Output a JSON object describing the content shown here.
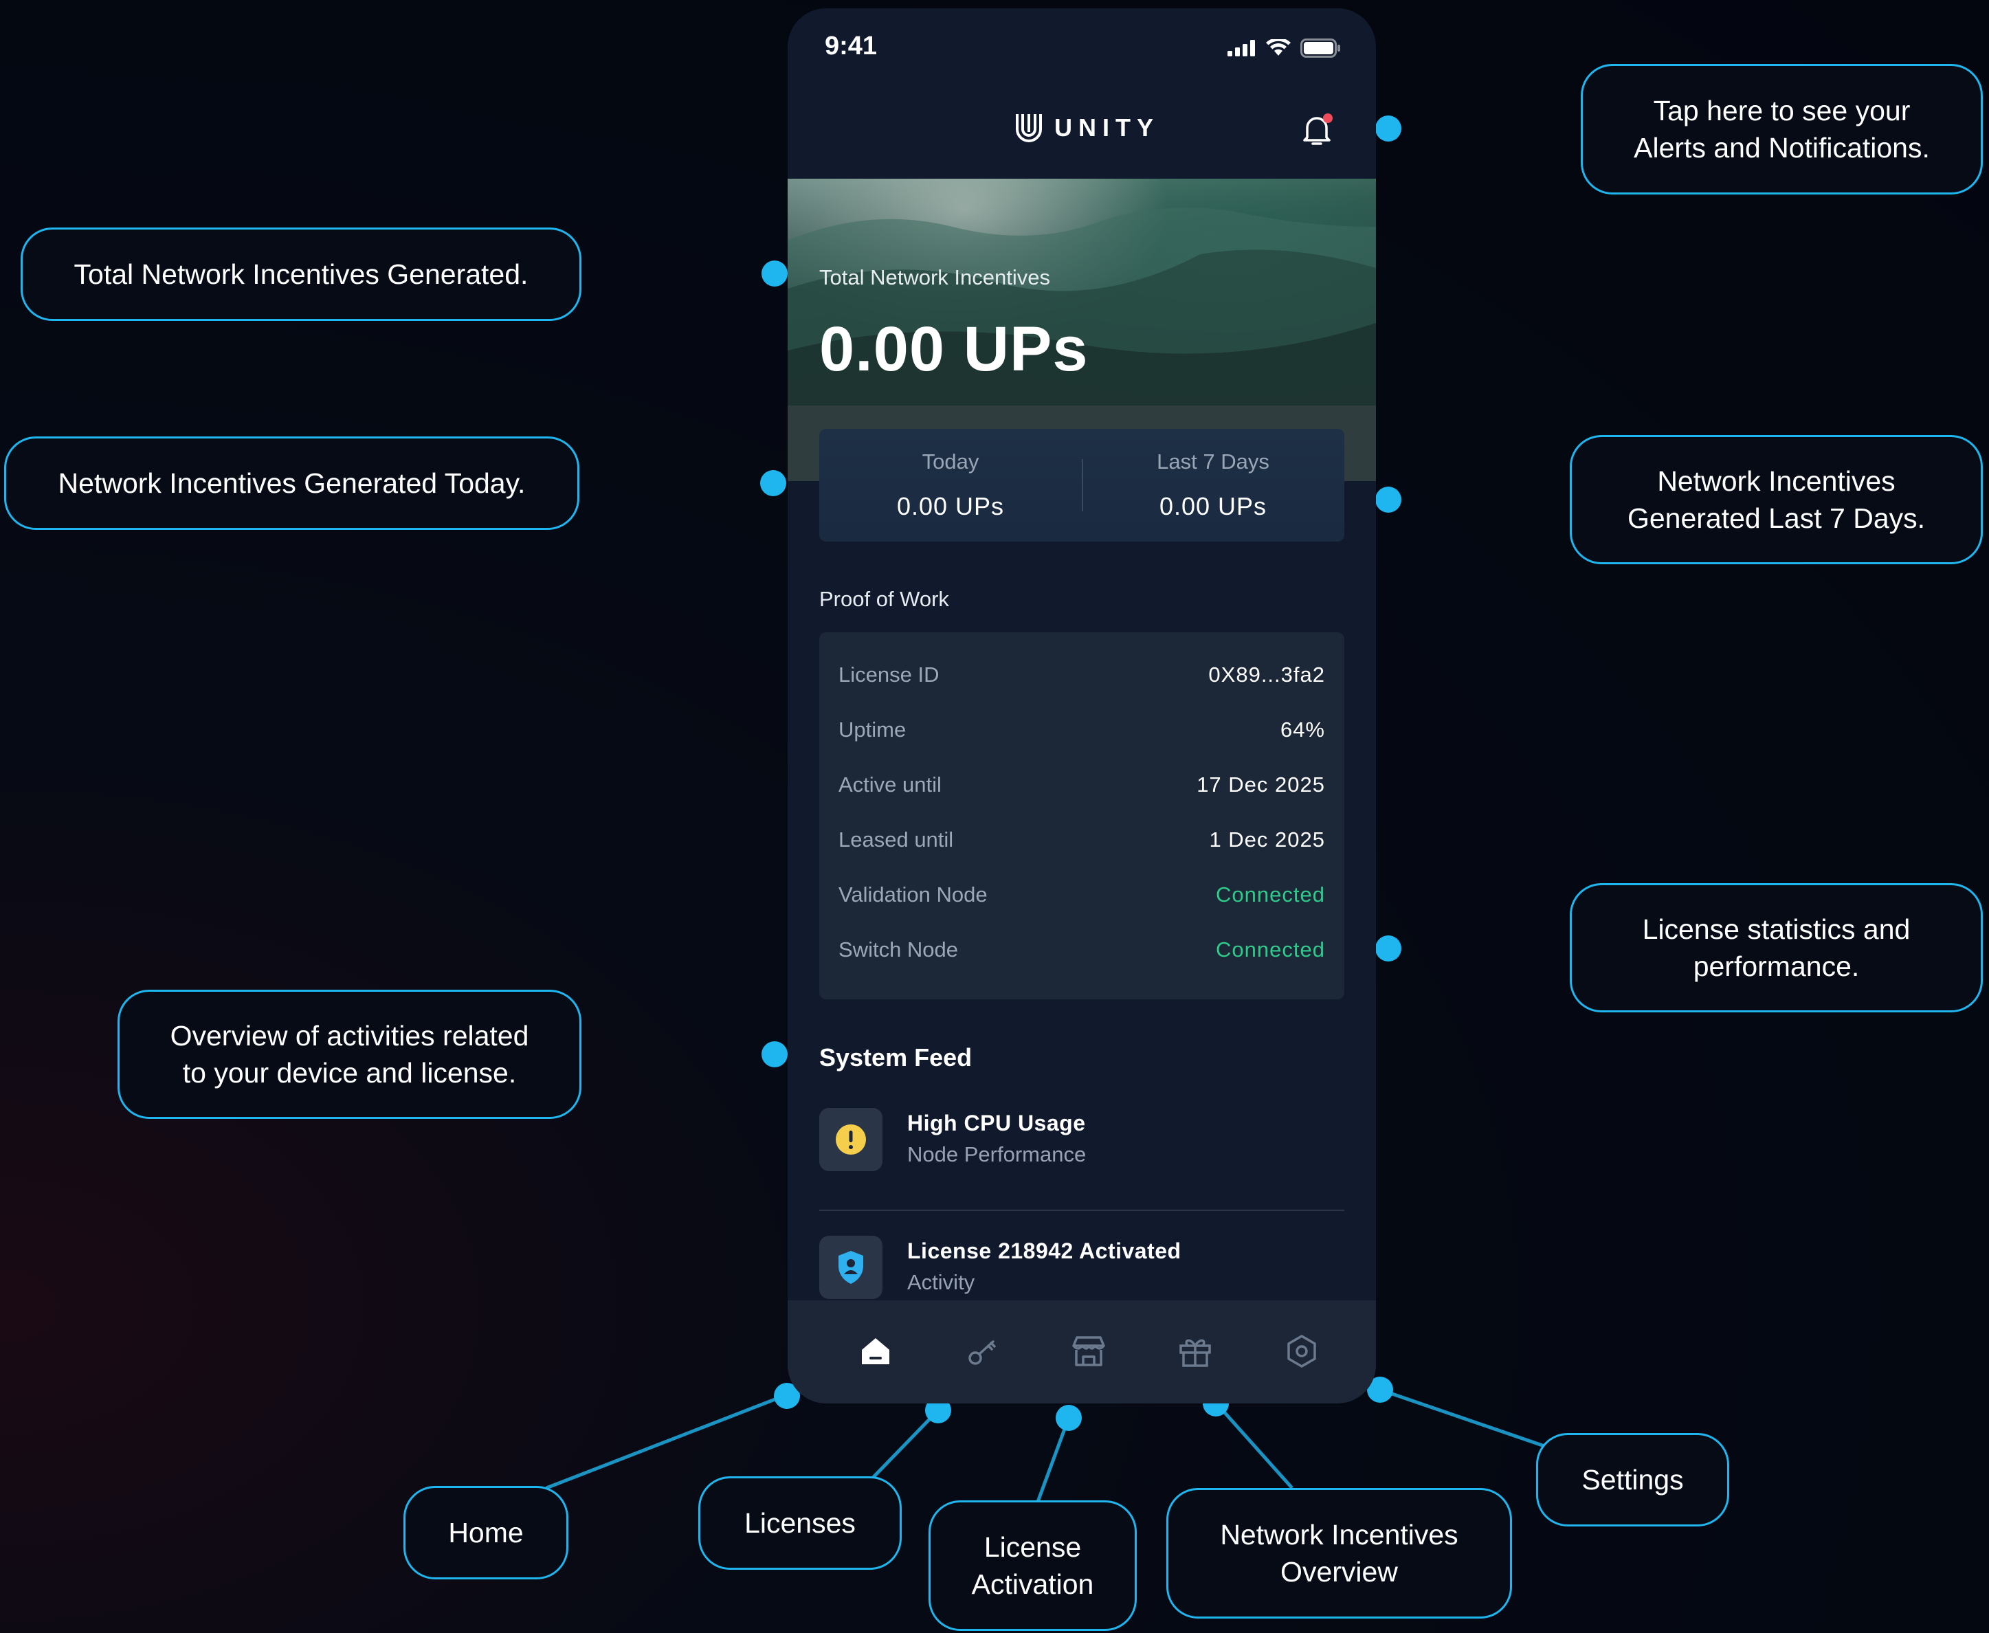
{
  "phone": {
    "status_bar": {
      "time": "9:41"
    },
    "header": {
      "brand": "UNITY"
    },
    "hero": {
      "label": "Total Network Incentives",
      "value": "0.00 UPs"
    },
    "stats": {
      "today_label": "Today",
      "today_value": "0.00 UPs",
      "week_label": "Last 7 Days",
      "week_value": "0.00 UPs"
    },
    "proof_of_work": {
      "title": "Proof of Work",
      "rows": [
        {
          "label": "License ID",
          "value": "0X89...3fa2"
        },
        {
          "label": "Uptime",
          "value": "64%"
        },
        {
          "label": "Active until",
          "value": "17 Dec 2025"
        },
        {
          "label": "Leased until",
          "value": "1 Dec 2025"
        },
        {
          "label": "Validation Node",
          "value": "Connected"
        },
        {
          "label": "Switch Node",
          "value": "Connected"
        }
      ]
    },
    "system_feed": {
      "title": "System Feed",
      "items": [
        {
          "title": "High CPU Usage",
          "subtitle": "Node Performance",
          "icon": "warning-icon"
        },
        {
          "title": "License 218942 Activated",
          "subtitle": "Activity",
          "icon": "shield-user-icon"
        }
      ]
    },
    "tabbar": {
      "tabs": [
        {
          "name": "home-icon",
          "active": true
        },
        {
          "name": "key-icon",
          "active": false
        },
        {
          "name": "store-icon",
          "active": false
        },
        {
          "name": "gift-icon",
          "active": false
        },
        {
          "name": "settings-hex-icon",
          "active": false
        }
      ]
    }
  },
  "callouts": {
    "alerts": "Tap here to see your\nAlerts and Notifications.",
    "total": "Total Network Incentives Generated.",
    "today": "Network Incentives Generated Today.",
    "last7": "Network Incentives\nGenerated Last 7 Days.",
    "license_stats": "License statistics and\nperformance.",
    "activity": "Overview of activities related\nto your device and license.",
    "home": "Home",
    "licenses": "Licenses",
    "license_activation": "License\nActivation",
    "incentives_overview": "Network Incentives\nOverview",
    "settings": "Settings"
  },
  "colors": {
    "accent": "#1fb6f0",
    "connected": "#2ecc8a",
    "warning": "#f5cf4b",
    "notification_dot": "#ef4b5b",
    "shield": "#2fb0ef"
  }
}
